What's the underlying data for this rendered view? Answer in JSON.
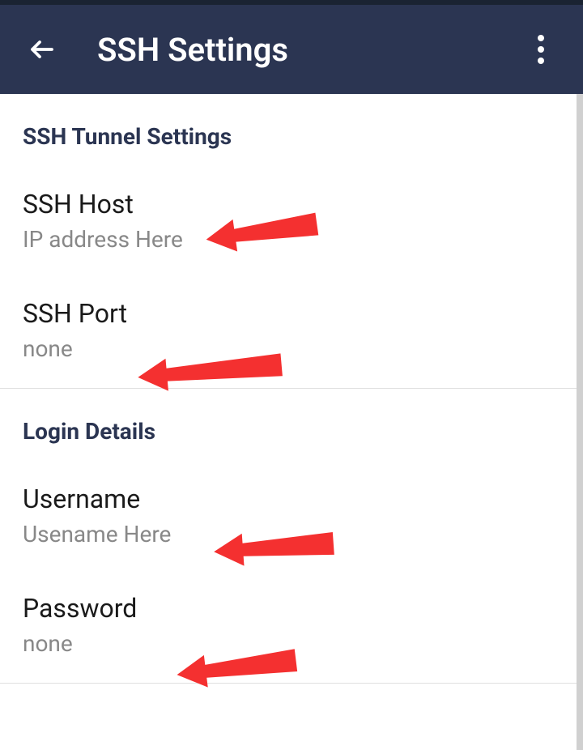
{
  "header": {
    "title": "SSH Settings"
  },
  "sections": {
    "tunnel": {
      "header": "SSH Tunnel Settings",
      "host": {
        "label": "SSH Host",
        "value": "IP address Here"
      },
      "port": {
        "label": "SSH Port",
        "value": "none"
      }
    },
    "login": {
      "header": "Login Details",
      "username": {
        "label": "Username",
        "value": "Usename Here"
      },
      "password": {
        "label": "Password",
        "value": "none"
      }
    }
  },
  "colors": {
    "headerBg": "#2b3552",
    "sectionHeader": "#2b3552",
    "arrowColor": "#f43030"
  }
}
